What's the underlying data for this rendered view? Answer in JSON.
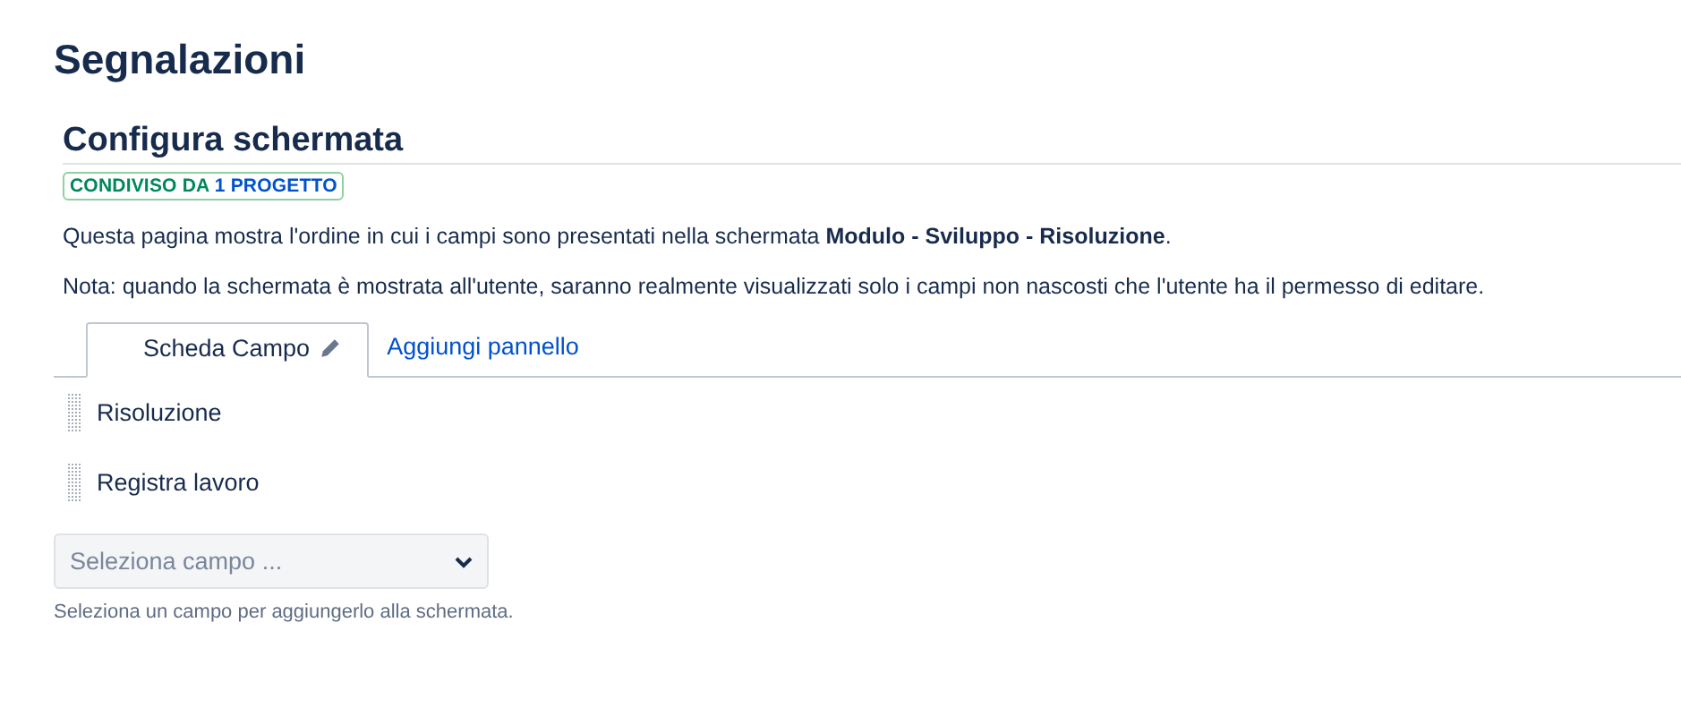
{
  "page_title": "Segnalazioni",
  "section_title": "Configura schermata",
  "badge": {
    "label": "CONDIVISO DA",
    "count": "1 PROGETTO"
  },
  "description": "Questa pagina mostra l'ordine in cui i campi sono presentati nella schermata **Modulo - Sviluppo - Risoluzione**.",
  "note": "Nota: quando la schermata è mostrata all'utente, saranno realmente visualizzati solo i campi non nascosti che l'utente ha il permesso di editare.",
  "tabs": [
    {
      "label": "Scheda Campo",
      "kind": "tab",
      "selected": true
    },
    {
      "label": "Aggiungi pannello",
      "kind": "link",
      "selected": false
    }
  ],
  "fields": [
    {
      "label": "Risoluzione"
    },
    {
      "label": "Registra lavoro"
    }
  ],
  "field_select": {
    "placeholder": "Seleziona campo ..."
  },
  "help_text": "Seleziona un campo per aggiungerlo alla schermata."
}
